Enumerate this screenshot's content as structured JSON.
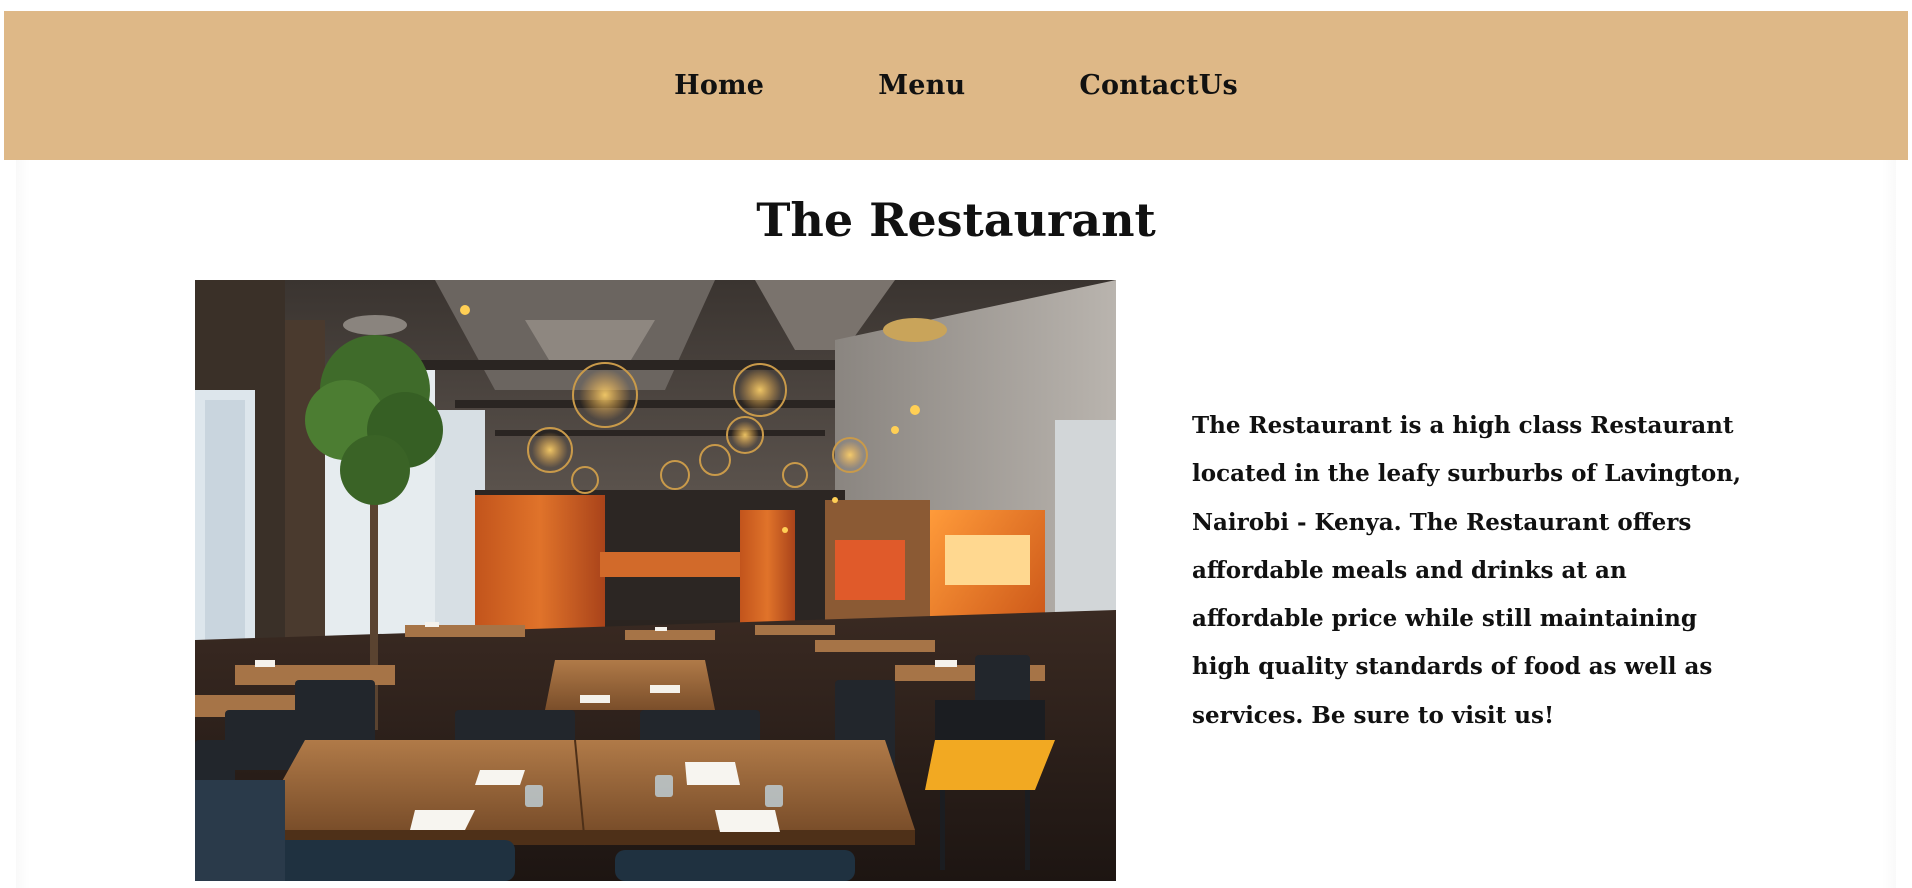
{
  "nav": {
    "items": [
      {
        "label": "Home"
      },
      {
        "label": "Menu"
      },
      {
        "label": "ContactUs"
      }
    ],
    "background_color": "#deb887"
  },
  "main": {
    "title": "The Restaurant",
    "image_alt": "Restaurant interior",
    "description": "The Restaurant is a high class Restaurant located in the leafy surburbs of Lavington, Nairobi - Kenya. The Restaurant offers affordable meals and drinks at an affordable price while still maintaining high quality standards of food as well as services. Be sure to visit us!"
  }
}
